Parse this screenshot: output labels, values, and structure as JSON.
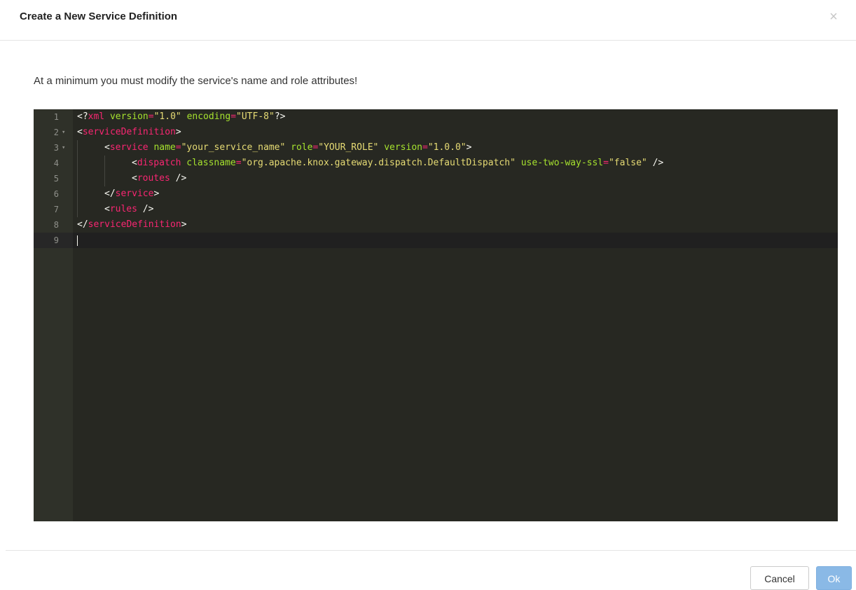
{
  "dialog": {
    "title": "Create a New Service Definition",
    "close_glyph": "×",
    "instruction": "At a minimum you must modify the service's name and role attributes!"
  },
  "editor": {
    "theme_colors": {
      "background": "#272822",
      "gutter": "#2f3129",
      "tag": "#f92672",
      "attribute": "#a6e22e",
      "string": "#e6db74",
      "text": "#f8f8f2"
    },
    "active_line": 9,
    "lines": [
      {
        "number": "1",
        "fold": "",
        "indent": 0,
        "text": "<?xml version=\"1.0\" encoding=\"UTF-8\"?>"
      },
      {
        "number": "2",
        "fold": "▾",
        "indent": 0,
        "text": "<serviceDefinition>"
      },
      {
        "number": "3",
        "fold": "▾",
        "indent": 1,
        "text": "<service name=\"your_service_name\" role=\"YOUR_ROLE\" version=\"1.0.0\">"
      },
      {
        "number": "4",
        "fold": "",
        "indent": 2,
        "text": "<dispatch classname=\"org.apache.knox.gateway.dispatch.DefaultDispatch\" use-two-way-ssl=\"false\" />"
      },
      {
        "number": "5",
        "fold": "",
        "indent": 2,
        "text": "<routes />"
      },
      {
        "number": "6",
        "fold": "",
        "indent": 1,
        "text": "</service>"
      },
      {
        "number": "7",
        "fold": "",
        "indent": 1,
        "text": "<rules />"
      },
      {
        "number": "8",
        "fold": "",
        "indent": 0,
        "text": "</serviceDefinition>"
      },
      {
        "number": "9",
        "fold": "",
        "indent": 0,
        "text": ""
      }
    ]
  },
  "footer": {
    "cancel_label": "Cancel",
    "ok_label": "Ok"
  }
}
